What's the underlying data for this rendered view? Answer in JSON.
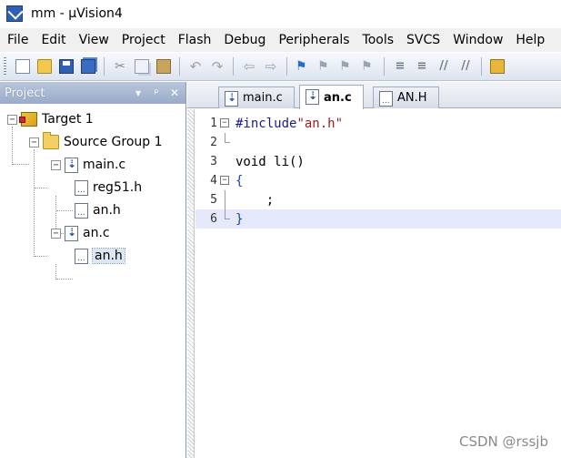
{
  "window": {
    "title": "mm  - µVision4"
  },
  "menu": {
    "items": [
      "File",
      "Edit",
      "View",
      "Project",
      "Flash",
      "Debug",
      "Peripherals",
      "Tools",
      "SVCS",
      "Window",
      "Help"
    ]
  },
  "toolbar": {
    "icons": [
      "new-file-icon",
      "open-file-icon",
      "save-icon",
      "save-all-icon",
      "cut-icon",
      "copy-icon",
      "paste-icon",
      "undo-icon",
      "redo-icon",
      "navigate-back-icon",
      "navigate-forward-icon",
      "bookmark-toggle-icon",
      "bookmark-prev-icon",
      "bookmark-next-icon",
      "bookmark-clear-icon",
      "indent-icon",
      "outdent-icon",
      "comment-icon",
      "uncomment-icon",
      "find-in-files-icon"
    ]
  },
  "project_panel": {
    "title": "Project",
    "pin_glyph": "ᵖ",
    "close_glyph": "✕",
    "dropdown_glyph": "▾",
    "tree": {
      "target": "Target 1",
      "group": "Source Group 1",
      "files": [
        {
          "name": "main.c",
          "children": [
            "reg51.h",
            "an.h"
          ]
        },
        {
          "name": "an.c",
          "children": [
            "an.h"
          ]
        }
      ]
    }
  },
  "editor": {
    "tabs": [
      {
        "label": "main.c",
        "kind": "c"
      },
      {
        "label": "an.c",
        "kind": "c",
        "active": true
      },
      {
        "label": "AN.H",
        "kind": "h"
      }
    ],
    "lines": [
      {
        "n": "1",
        "text_pre": "#include",
        "text_str": "\"an.h\""
      },
      {
        "n": "2",
        "text": ""
      },
      {
        "n": "3",
        "text": "void li()"
      },
      {
        "n": "4",
        "text": "{"
      },
      {
        "n": "5",
        "text": "    ;"
      },
      {
        "n": "6",
        "text": "}"
      }
    ]
  },
  "watermark": "CSDN @rssjb",
  "colors": {
    "panel_header": "#9aabc8",
    "current_line": "#e6e9fb",
    "string": "#9b1c1c",
    "brace": "#1a3fb5"
  }
}
